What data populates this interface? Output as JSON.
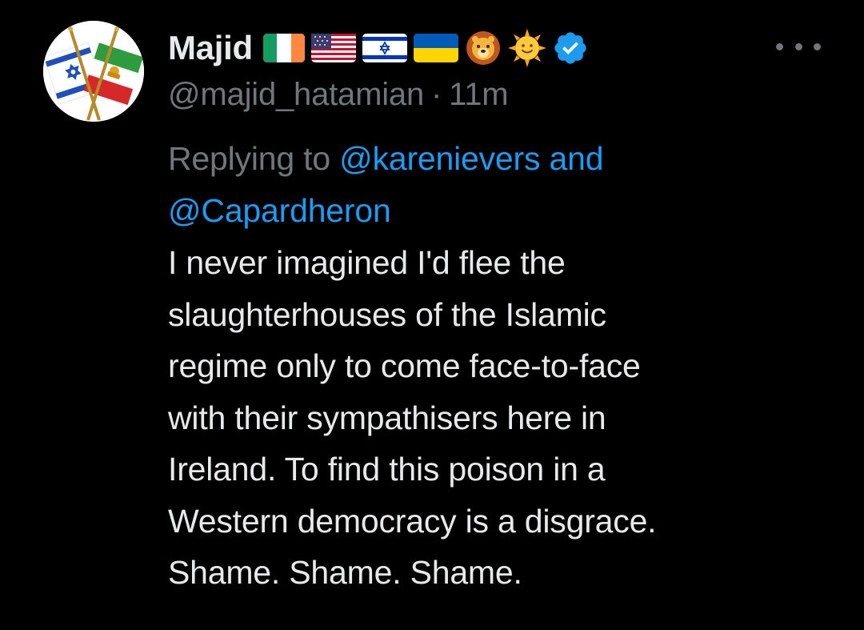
{
  "tweet": {
    "author": {
      "display_name": "Majid",
      "handle": "@majid_hatamian",
      "verified": true,
      "avatar": "israel-iran-lion-sun-crossed-flags-icon",
      "name_emojis": [
        "ireland-flag-icon",
        "usa-flag-icon",
        "israel-flag-icon",
        "ukraine-flag-icon",
        "lion-icon",
        "sun-icon"
      ]
    },
    "separator": "·",
    "timestamp": "11m",
    "reply_context": {
      "prefix": "Replying to",
      "mention_1": "@karenievers",
      "joiner": "and",
      "mention_2": "@Capardheron"
    },
    "text_lines": [
      "I never imagined I'd flee the",
      "slaughterhouses of the Islamic",
      "regime only to come face-to-face",
      "with their sympathisers here in",
      "Ireland. To find this poison in a",
      "Western democracy is a disgrace.",
      "Shame. Shame. Shame."
    ]
  },
  "colors": {
    "background": "#000000",
    "primary_text": "#e7e9ea",
    "secondary_text": "#71767b",
    "link": "#1d9bf0",
    "verified_badge": "#1d9bf0"
  }
}
